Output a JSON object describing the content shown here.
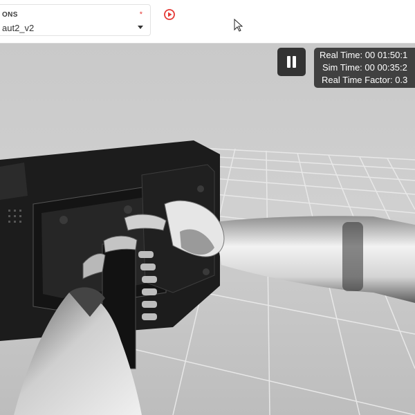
{
  "toolbar": {
    "selector_label": "ONS",
    "selector_required": "*",
    "selector_value": "aut2_v2",
    "run_icon": "play-circle-icon"
  },
  "overlay": {
    "pause_icon": "pause-icon",
    "real_time": "Real Time: 00 01:50:1",
    "sim_time": "Sim Time: 00 00:35:2",
    "real_time_factor": "Real Time Factor: 0.3"
  },
  "colors": {
    "accent_red": "#e53935",
    "scene_background": "#cfcfcf",
    "overlay_background": "#333333"
  }
}
